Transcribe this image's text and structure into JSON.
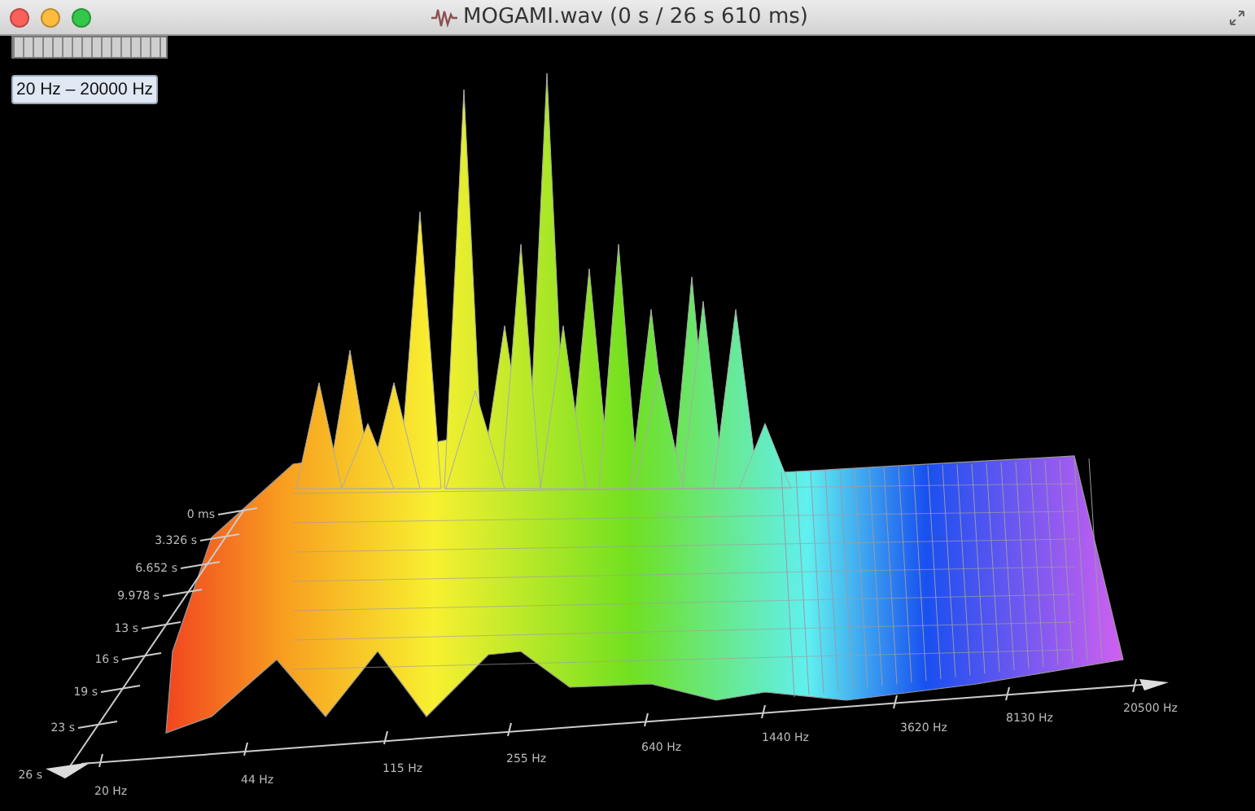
{
  "window": {
    "title": "MOGAMI.wav (0 s / 26 s 610 ms)"
  },
  "range_button": {
    "label": "20 Hz – 20000 Hz"
  },
  "time_axis": {
    "labels": [
      "0 ms",
      "3.326 s",
      "6.652 s",
      "9.978 s",
      "13 s",
      "16 s",
      "19 s",
      "23 s",
      "26 s"
    ]
  },
  "frequency_axis": {
    "labels": [
      "20 Hz",
      "44 Hz",
      "115 Hz",
      "255 Hz",
      "640 Hz",
      "1440 Hz",
      "3620 Hz",
      "8130 Hz",
      "20500 Hz"
    ]
  }
}
